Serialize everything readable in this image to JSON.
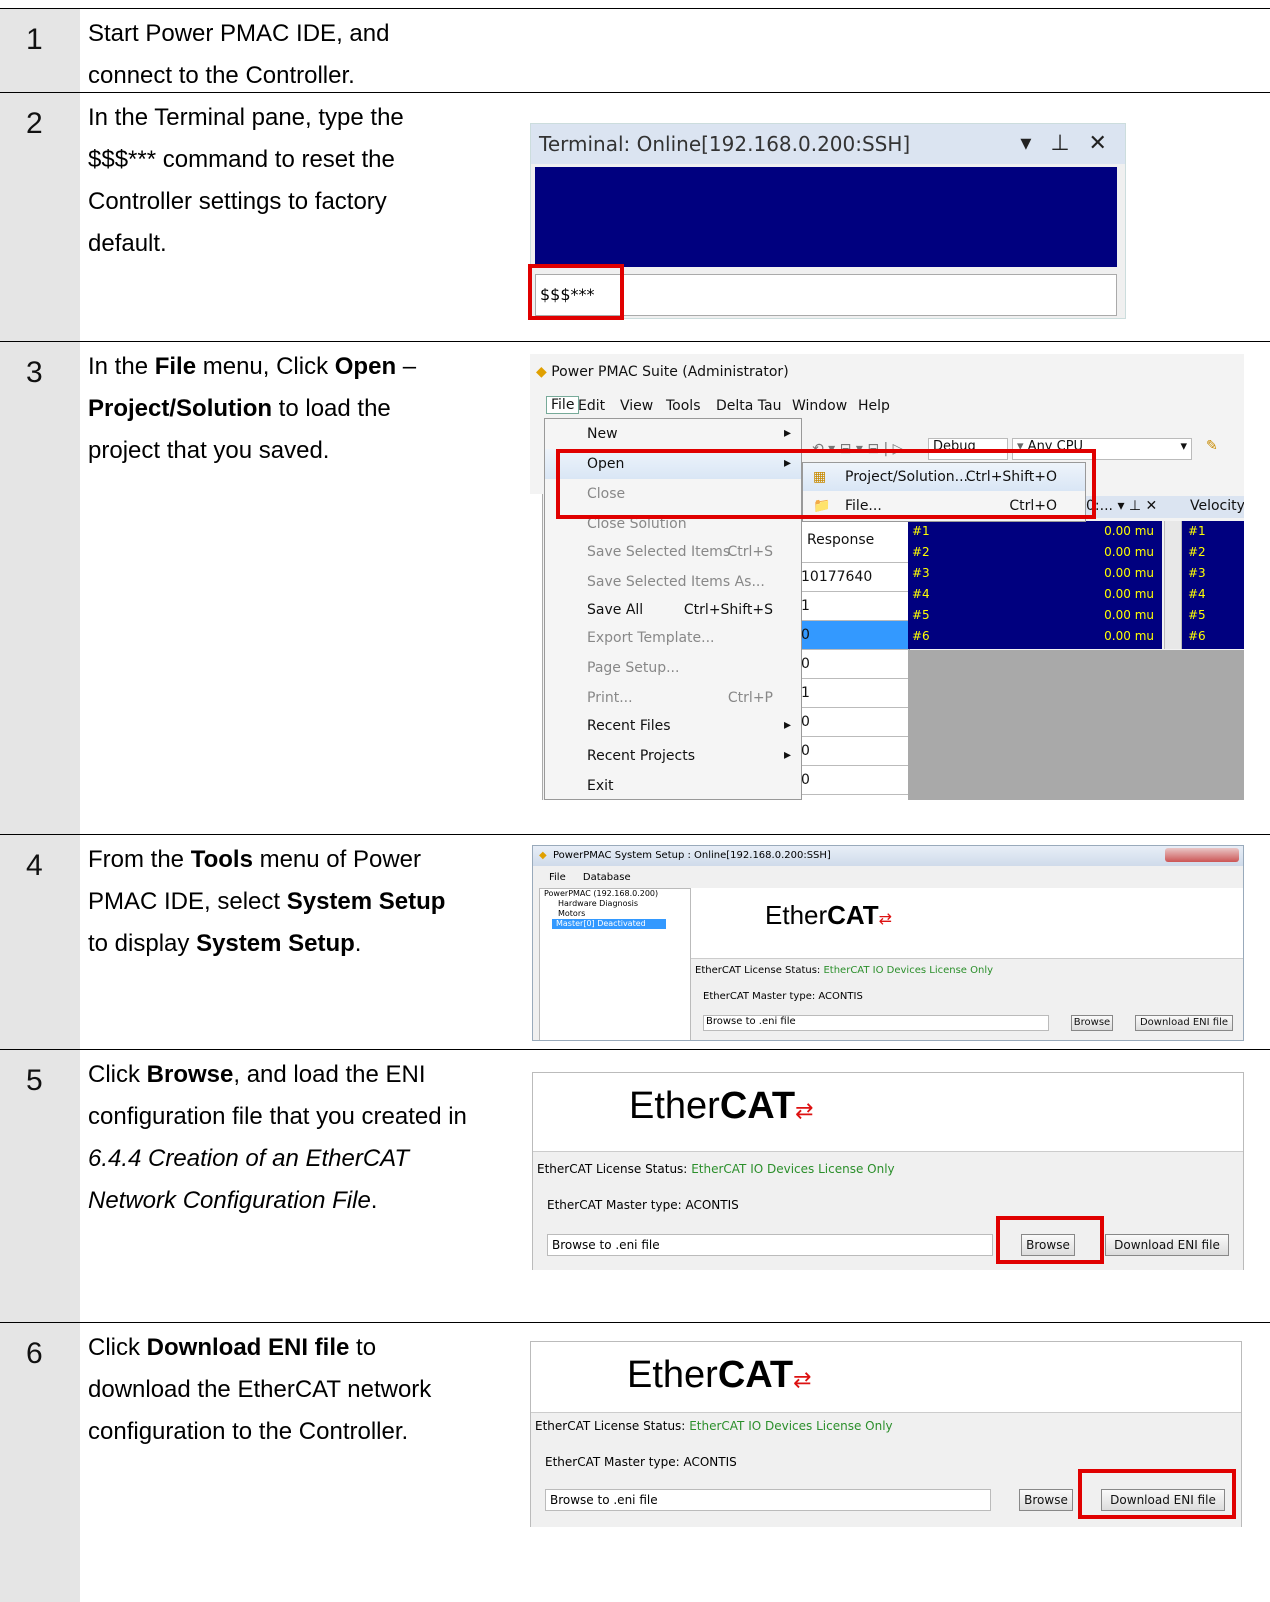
{
  "steps": [
    {
      "num": "1",
      "text_html": "Start Power PMAC IDE, and<br>connect to the Controller."
    },
    {
      "num": "2",
      "text_html": "In the Terminal pane, type the<br>$$$*** command to reset the<br>Controller settings to factory<br>default."
    },
    {
      "num": "3",
      "text_html": "In the <b>File</b> menu, Click <b>Open</b> –<br><b>Project/Solution</b> to load the<br>project that you saved."
    },
    {
      "num": "4",
      "text_html": "From the <b>Tools</b> menu of Power<br>PMAC IDE, select <b>System Setup</b><br>to display <b>System Setup</b>."
    },
    {
      "num": "5",
      "text_html": "Click <b>Browse</b>, and load the ENI<br>configuration file that you created in<br><i>6.4.4 Creation of an EtherCAT</i><br><i>Network Configuration File</i>."
    },
    {
      "num": "6",
      "text_html": "Click <b>Download ENI file</b> to<br>download the EtherCAT network<br>configuration to the Controller."
    }
  ],
  "terminal": {
    "title": "Terminal: Online[192.168.0.200:SSH]",
    "controls": "▾ ⊥ ✕",
    "input": "$$$***"
  },
  "ide": {
    "title": "Power PMAC Suite (Administrator)",
    "menubar": [
      "File",
      "Edit",
      "View",
      "Tools",
      "Delta Tau",
      "Window",
      "Help"
    ],
    "file_menu": [
      {
        "label": "New",
        "shortcut": "",
        "arrow": true,
        "disabled": false
      },
      {
        "label": "Open",
        "shortcut": "",
        "arrow": true,
        "disabled": false
      },
      {
        "label": "Close",
        "shortcut": "",
        "arrow": false,
        "disabled": true
      },
      {
        "label": "Close Solution",
        "shortcut": "",
        "arrow": false,
        "disabled": true
      },
      {
        "label": "Save Selected Items",
        "shortcut": "Ctrl+S",
        "arrow": false,
        "disabled": true
      },
      {
        "label": "Save Selected Items As...",
        "shortcut": "",
        "arrow": false,
        "disabled": true
      },
      {
        "label": "Save All",
        "shortcut": "Ctrl+Shift+S",
        "arrow": false,
        "disabled": false
      },
      {
        "label": "Export Template...",
        "shortcut": "",
        "arrow": false,
        "disabled": true
      },
      {
        "label": "Page Setup...",
        "shortcut": "",
        "arrow": false,
        "disabled": true
      },
      {
        "label": "Print...",
        "shortcut": "Ctrl+P",
        "arrow": false,
        "disabled": true
      },
      {
        "label": "Recent Files",
        "shortcut": "",
        "arrow": true,
        "disabled": false
      },
      {
        "label": "Recent Projects",
        "shortcut": "",
        "arrow": true,
        "disabled": false
      },
      {
        "label": "Exit",
        "shortcut": "",
        "arrow": false,
        "disabled": false
      }
    ],
    "open_submenu": [
      {
        "label": "Project/Solution...",
        "shortcut": "Ctrl+Shift+O"
      },
      {
        "label": "File...",
        "shortcut": "Ctrl+O"
      }
    ],
    "toolbar": {
      "config": "Debug",
      "platform": "Any CPU"
    },
    "response_header": "Response",
    "response_values": [
      "10177640",
      "1",
      "0",
      "0",
      "1",
      "0",
      "0",
      "0",
      "0"
    ],
    "position_rows": [
      "#1",
      "#2",
      "#3",
      "#4",
      "#5",
      "#6"
    ],
    "position_value": "0.00 mu",
    "velocity_label": "Velocity:",
    "pane_title": "0:...",
    "pane_controls": "▾ ⊥ ✕"
  },
  "setup": {
    "title": "PowerPMAC System Setup  : Online[192.168.0.200:SSH]",
    "menus": [
      "File",
      "Database"
    ],
    "tree": [
      "PowerPMAC (192.168.0.200)",
      "Hardware Diagnosis",
      "Motors",
      "Master[0] Deactivated"
    ],
    "logo_a": "Ether",
    "logo_b": "CAT",
    "license_label": "EtherCAT License Status:",
    "license_value": "EtherCAT IO Devices License Only",
    "master_type": "EtherCAT Master type:  ACONTIS",
    "eni_placeholder": "Browse to .eni file",
    "browse": "Browse",
    "download": "Download ENI file"
  },
  "colors": {
    "highlight": "#e00000",
    "terminal_bg": "#00007f",
    "license_green": "#2b8f2b",
    "step_bg": "#e5e5e5"
  }
}
